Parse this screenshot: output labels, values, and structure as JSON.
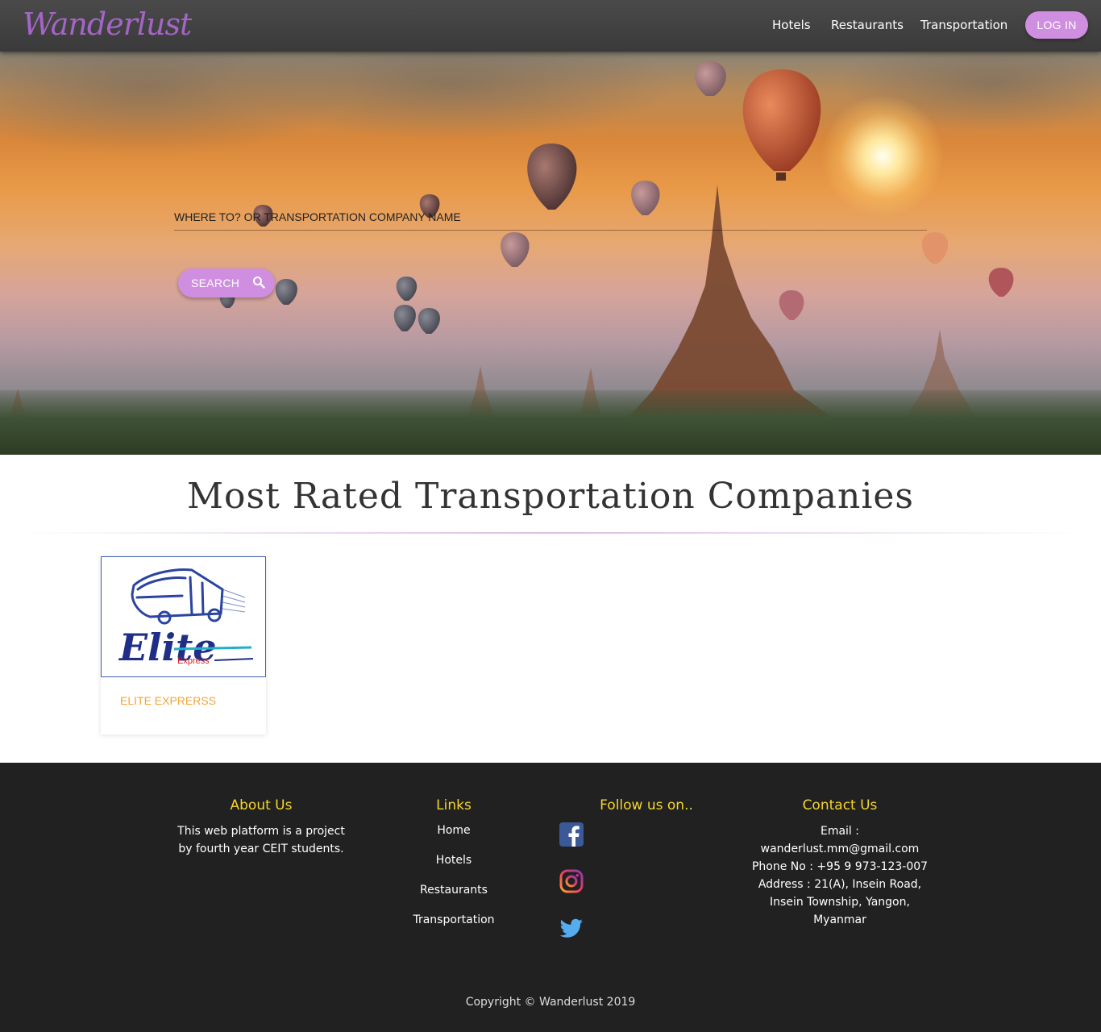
{
  "brand": {
    "name": "Wanderlust",
    "accent": "#d08ee0",
    "logo_color": "#a565c8"
  },
  "nav": {
    "links": [
      {
        "label": "Hotels"
      },
      {
        "label": "Restaurants"
      },
      {
        "label": "Transportation"
      }
    ],
    "login_label": "LOG IN"
  },
  "hero": {
    "search_placeholder": "WHERE TO? OR TRANSPORTATION COMPANY NAME",
    "search_value": "",
    "search_button_label": "SEARCH",
    "search_icon": "search-icon"
  },
  "section": {
    "title": "Most Rated Transportation Companies"
  },
  "companies": [
    {
      "name": "ELITE EXPRERSS",
      "logo_text": "Elite",
      "logo_subtext": "Express"
    }
  ],
  "footer": {
    "title_color": "#f5d52c",
    "about": {
      "title": "About Us",
      "line1": "This web platform is a project",
      "line2": "by fourth year CEIT students."
    },
    "links": {
      "title": "Links",
      "items": [
        "Home",
        "Hotels",
        "Restaurants",
        "Transportation"
      ]
    },
    "follow": {
      "title": "Follow us on..",
      "icons": [
        "facebook-icon",
        "instagram-icon",
        "twitter-icon"
      ]
    },
    "contact": {
      "title": "Contact Us",
      "email_label": "Email :",
      "email": "wanderlust.mm@gmail.com",
      "phone": "Phone No : +95 9 973-123-007",
      "address_line1": "Address : 21(A), Insein Road,",
      "address_line2": "Insein Township, Yangon,",
      "address_line3": "Myanmar"
    },
    "copyright": "Copyright © Wanderlust 2019"
  }
}
